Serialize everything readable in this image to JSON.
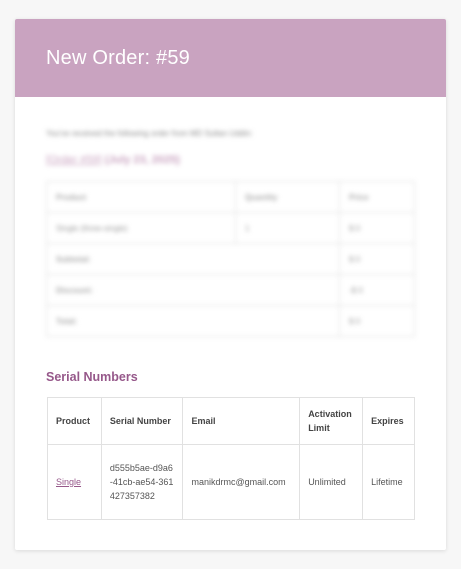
{
  "header": {
    "title": "New Order: #59"
  },
  "intro": "You've received the following order from MD Sultan Uddin:",
  "order": {
    "link_text": "[Order #59]",
    "date_text": "(July 23, 2025)"
  },
  "summary": {
    "columns": [
      "Product",
      "Quantity",
      "Price"
    ],
    "item": {
      "product": "Single (three-single)",
      "quantity": "1",
      "price": "$ 0"
    },
    "totals": [
      {
        "label": "Subtotal:",
        "value": "$ 0"
      },
      {
        "label": "Discount:",
        "value": "-$ 0"
      },
      {
        "label": "Total:",
        "value": "$ 0"
      }
    ]
  },
  "serials": {
    "heading": "Serial Numbers",
    "columns": [
      "Product",
      "Serial Number",
      "Email",
      "Activation Limit",
      "Expires"
    ],
    "row": {
      "product": "Single",
      "serial": "d555b5ae-d9a6-41cb-ae54-361427357382",
      "email": "manikdrmc@gmail.com",
      "limit": "Unlimited",
      "expires": "Lifetime"
    }
  }
}
